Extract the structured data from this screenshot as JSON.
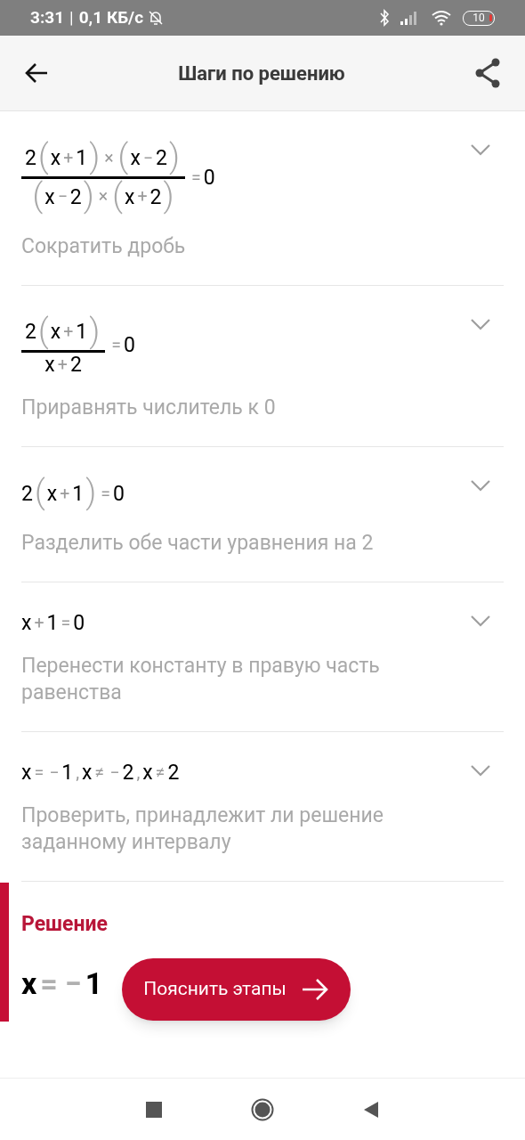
{
  "status_bar": {
    "time": "3:31",
    "separator": "|",
    "speed": "0,1 КБ/с",
    "battery": "10"
  },
  "header": {
    "title": "Шаги по решению"
  },
  "steps": [
    {
      "expanded": false,
      "expression": {
        "kind": "fraction",
        "numerator": [
          {
            "text": "2",
            "kind": "sym"
          },
          {
            "text": "(",
            "kind": "paren"
          },
          {
            "text": "x",
            "kind": "sym"
          },
          {
            "text": "+",
            "kind": "op"
          },
          {
            "text": "1",
            "kind": "sym"
          },
          {
            "text": ")",
            "kind": "paren"
          },
          {
            "text": "×",
            "kind": "op"
          },
          {
            "text": "(",
            "kind": "paren"
          },
          {
            "text": "x",
            "kind": "sym"
          },
          {
            "text": "−",
            "kind": "op"
          },
          {
            "text": "2",
            "kind": "sym"
          },
          {
            "text": ")",
            "kind": "paren"
          }
        ],
        "denominator": [
          {
            "text": "(",
            "kind": "paren"
          },
          {
            "text": "x",
            "kind": "sym"
          },
          {
            "text": "−",
            "kind": "op"
          },
          {
            "text": "2",
            "kind": "sym"
          },
          {
            "text": ")",
            "kind": "paren"
          },
          {
            "text": "×",
            "kind": "op"
          },
          {
            "text": "(",
            "kind": "paren"
          },
          {
            "text": "x",
            "kind": "sym"
          },
          {
            "text": "+",
            "kind": "op"
          },
          {
            "text": "2",
            "kind": "sym"
          },
          {
            "text": ")",
            "kind": "paren"
          }
        ],
        "rest": [
          {
            "text": "=",
            "kind": "op"
          },
          {
            "text": "0",
            "kind": "sym"
          }
        ]
      },
      "description": "Сократить дробь"
    },
    {
      "expanded": false,
      "expression": {
        "kind": "fraction",
        "numerator": [
          {
            "text": "2",
            "kind": "sym"
          },
          {
            "text": "(",
            "kind": "paren"
          },
          {
            "text": "x",
            "kind": "sym"
          },
          {
            "text": "+",
            "kind": "op"
          },
          {
            "text": "1",
            "kind": "sym"
          },
          {
            "text": ")",
            "kind": "paren"
          }
        ],
        "denominator": [
          {
            "text": "x",
            "kind": "sym"
          },
          {
            "text": "+",
            "kind": "op"
          },
          {
            "text": "2",
            "kind": "sym"
          }
        ],
        "rest": [
          {
            "text": "=",
            "kind": "op"
          },
          {
            "text": "0",
            "kind": "sym"
          }
        ]
      },
      "description": "Приравнять числитель к 0"
    },
    {
      "expanded": false,
      "expression": {
        "kind": "line",
        "tokens": [
          {
            "text": "2",
            "kind": "sym"
          },
          {
            "text": "(",
            "kind": "paren"
          },
          {
            "text": "x",
            "kind": "sym"
          },
          {
            "text": "+",
            "kind": "op"
          },
          {
            "text": "1",
            "kind": "sym"
          },
          {
            "text": ")",
            "kind": "paren"
          },
          {
            "text": "=",
            "kind": "op"
          },
          {
            "text": "0",
            "kind": "sym"
          }
        ]
      },
      "description": "Разделить обе части уравнения на 2"
    },
    {
      "expanded": false,
      "expression": {
        "kind": "line",
        "tokens": [
          {
            "text": "x",
            "kind": "sym"
          },
          {
            "text": "+",
            "kind": "op"
          },
          {
            "text": "1",
            "kind": "sym"
          },
          {
            "text": "=",
            "kind": "op"
          },
          {
            "text": "0",
            "kind": "sym"
          }
        ]
      },
      "description": "Перенести константу в правую часть равенства"
    },
    {
      "expanded": false,
      "expression": {
        "kind": "line",
        "tokens": [
          {
            "text": "x",
            "kind": "sym"
          },
          {
            "text": "=",
            "kind": "op"
          },
          {
            "text": "−",
            "kind": "op"
          },
          {
            "text": "1",
            "kind": "sym"
          },
          {
            "text": ",",
            "kind": "op"
          },
          {
            "text": "x",
            "kind": "sym"
          },
          {
            "text": "≠",
            "kind": "op"
          },
          {
            "text": "−",
            "kind": "op"
          },
          {
            "text": "2",
            "kind": "sym"
          },
          {
            "text": ",",
            "kind": "op"
          },
          {
            "text": "x",
            "kind": "sym"
          },
          {
            "text": "≠",
            "kind": "op"
          },
          {
            "text": "2",
            "kind": "sym"
          }
        ]
      },
      "description": "Проверить, принадлежит ли решение заданному интервалу"
    }
  ],
  "solution": {
    "title": "Решение",
    "answer": [
      {
        "text": "x",
        "kind": "sym"
      },
      {
        "text": "=",
        "kind": "op"
      },
      {
        "text": "−",
        "kind": "op"
      },
      {
        "text": "1",
        "kind": "sym"
      }
    ],
    "button": "Пояснить этапы"
  }
}
